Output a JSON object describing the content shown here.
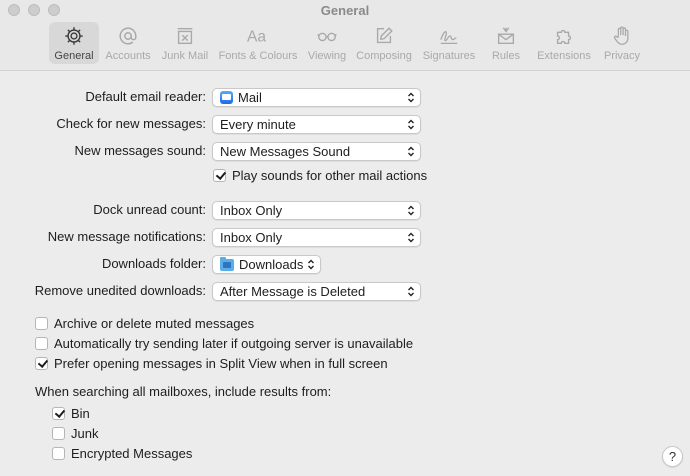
{
  "window": {
    "title": "General"
  },
  "toolbar": {
    "items": [
      {
        "label": "General",
        "icon": "gear-icon",
        "active": true
      },
      {
        "label": "Accounts",
        "icon": "at-icon",
        "active": false
      },
      {
        "label": "Junk Mail",
        "icon": "junk-mail-icon",
        "active": false
      },
      {
        "label": "Fonts & Colours",
        "icon": "fonts-icon",
        "active": false
      },
      {
        "label": "Viewing",
        "icon": "glasses-icon",
        "active": false
      },
      {
        "label": "Composing",
        "icon": "compose-icon",
        "active": false
      },
      {
        "label": "Signatures",
        "icon": "signature-icon",
        "active": false
      },
      {
        "label": "Rules",
        "icon": "rules-icon",
        "active": false
      },
      {
        "label": "Extensions",
        "icon": "puzzle-icon",
        "active": false
      },
      {
        "label": "Privacy",
        "icon": "hand-icon",
        "active": false
      }
    ]
  },
  "settings": {
    "default_reader": {
      "label": "Default email reader:",
      "value": "Mail"
    },
    "check_messages": {
      "label": "Check for new messages:",
      "value": "Every minute"
    },
    "messages_sound": {
      "label": "New messages sound:",
      "value": "New Messages Sound"
    },
    "play_sounds": {
      "label": "Play sounds for other mail actions",
      "checked": true
    },
    "dock_unread": {
      "label": "Dock unread count:",
      "value": "Inbox Only"
    },
    "notifications": {
      "label": "New message notifications:",
      "value": "Inbox Only"
    },
    "downloads_folder": {
      "label": "Downloads folder:",
      "value": "Downloads"
    },
    "remove_downloads": {
      "label": "Remove unedited downloads:",
      "value": "After Message is Deleted"
    }
  },
  "checkboxes": {
    "archive_muted": {
      "label": "Archive or delete muted messages",
      "checked": false
    },
    "auto_send_later": {
      "label": "Automatically try sending later if outgoing server is unavailable",
      "checked": false
    },
    "split_view": {
      "label": "Prefer opening messages in Split View when in full screen",
      "checked": true
    }
  },
  "search": {
    "heading": "When searching all mailboxes, include results from:",
    "bin": {
      "label": "Bin",
      "checked": true
    },
    "junk": {
      "label": "Junk",
      "checked": false
    },
    "encrypted": {
      "label": "Encrypted Messages",
      "checked": false
    }
  },
  "help": {
    "label": "?"
  }
}
